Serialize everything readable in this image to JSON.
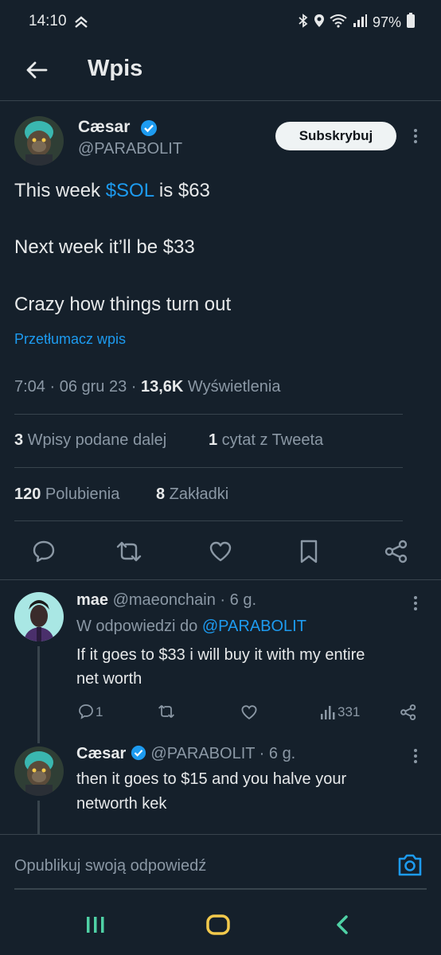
{
  "status_bar": {
    "time": "14:10",
    "battery": "97%"
  },
  "header": {
    "title": "Wpis"
  },
  "tweet": {
    "author_name": "Cæsar",
    "author_handle": "@PARABOLIT",
    "subscribe_label": "Subskrybuj",
    "line1_before": "This week ",
    "line1_cashtag": "$SOL",
    "line1_after": " is $63",
    "line2": "Next week it’ll be $33",
    "line3": "Crazy how things turn out",
    "translate_label": "Przetłumacz wpis",
    "meta_time": "7:04 · 06 gru 23 · ",
    "views_count": "13,6K",
    "views_label": " Wyświetlenia",
    "reposts_count": "3",
    "reposts_label": " Wpisy podane dalej",
    "quotes_count": "1",
    "quotes_label": " cytat z Tweeta",
    "likes_count": "120",
    "likes_label": " Polubienia",
    "bookmarks_count": "8",
    "bookmarks_label": " Zakładki"
  },
  "replies": [
    {
      "name": "mae",
      "handle": "@maeonchain",
      "time": " · 6 g.",
      "replying_prefix": "W odpowiedzi do ",
      "replying_handle": "@PARABOLIT",
      "text_line1": "If it goes to $33 i will buy it with my entire",
      "text_line2": "net worth",
      "reply_count": "1",
      "views": "331"
    },
    {
      "name": "Cæsar",
      "handle": "@PARABOLIT",
      "time": " · 6 g.",
      "text_line1": "then it goes to $15 and you halve your",
      "text_line2": "networth kek"
    }
  ],
  "reply_bar": {
    "placeholder": "Opublikuj swoją odpowiedź"
  },
  "colors": {
    "background": "#15202b",
    "accent": "#1d9bf0",
    "muted": "#8b98a5",
    "divider": "#38444d"
  }
}
